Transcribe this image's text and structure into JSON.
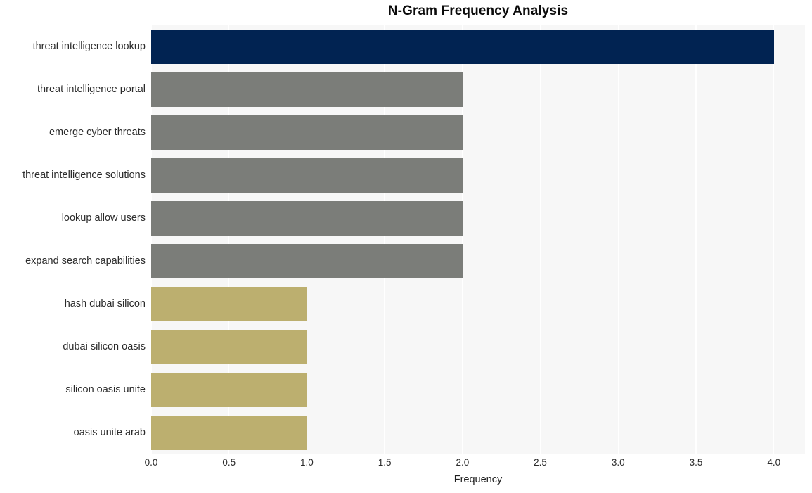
{
  "chart_data": {
    "type": "bar",
    "orientation": "horizontal",
    "title": "N-Gram Frequency Analysis",
    "xlabel": "Frequency",
    "ylabel": "",
    "xlim": [
      0,
      4.2
    ],
    "xticks": [
      "0.0",
      "0.5",
      "1.0",
      "1.5",
      "2.0",
      "2.5",
      "3.0",
      "3.5",
      "4.0"
    ],
    "xtick_values": [
      0.0,
      0.5,
      1.0,
      1.5,
      2.0,
      2.5,
      3.0,
      3.5,
      4.0
    ],
    "grid": true,
    "grid_axis": "x",
    "grid_color": "#ffffff",
    "plot_background": "#f7f7f7",
    "legend": null,
    "categories": [
      "threat intelligence lookup",
      "threat intelligence portal",
      "emerge cyber threats",
      "threat intelligence solutions",
      "lookup allow users",
      "expand search capabilities",
      "hash dubai silicon",
      "dubai silicon oasis",
      "silicon oasis unite",
      "oasis unite arab"
    ],
    "values": [
      4,
      2,
      2,
      2,
      2,
      2,
      1,
      1,
      1,
      1
    ],
    "bar_colors": [
      "#012352",
      "#7b7d79",
      "#7b7d79",
      "#7b7d79",
      "#7b7d79",
      "#7b7d79",
      "#bcaf6f",
      "#bcaf6f",
      "#bcaf6f",
      "#bcaf6f"
    ]
  },
  "colors": {
    "accent_high": "#012352",
    "accent_mid": "#7b7d79",
    "accent_low": "#bcaf6f",
    "plot_bg": "#f7f7f7",
    "grid": "#ffffff",
    "text": "#2b2b2b"
  }
}
